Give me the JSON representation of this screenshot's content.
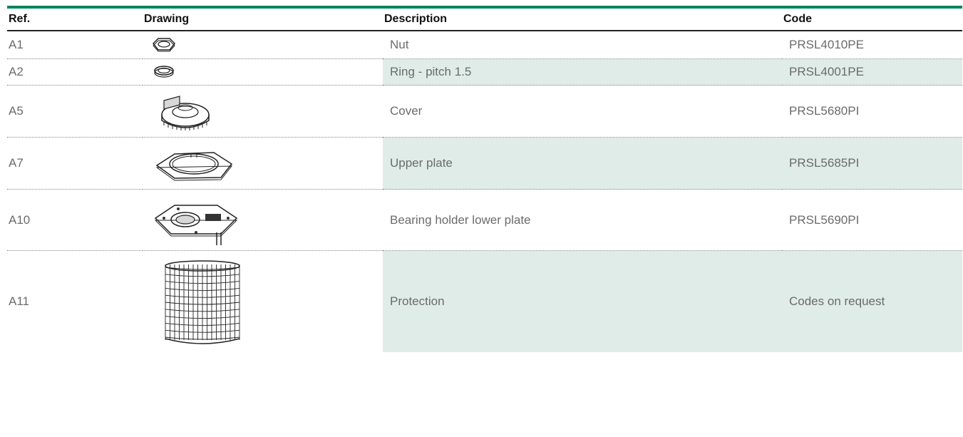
{
  "table": {
    "headers": {
      "ref": "Ref.",
      "drawing": "Drawing",
      "description": "Description",
      "code": "Code"
    },
    "rows": [
      {
        "ref": "A1",
        "drawing_icon": "hex-nut-icon",
        "description": "Nut",
        "code": "PRSL4010PE",
        "shaded": false
      },
      {
        "ref": "A2",
        "drawing_icon": "ring-icon",
        "description": "Ring - pitch 1.5",
        "code": "PRSL4001PE",
        "shaded": true
      },
      {
        "ref": "A5",
        "drawing_icon": "cover-icon",
        "description": "Cover",
        "code": "PRSL5680PI",
        "shaded": false
      },
      {
        "ref": "A7",
        "drawing_icon": "upper-plate-icon",
        "description": "Upper plate",
        "code": "PRSL5685PI",
        "shaded": true
      },
      {
        "ref": "A10",
        "drawing_icon": "bearing-plate-icon",
        "description": "Bearing holder lower plate",
        "code": "PRSL5690PI",
        "shaded": false
      },
      {
        "ref": "A11",
        "drawing_icon": "protection-grid-icon",
        "description": "Protection",
        "code": "Codes on request",
        "shaded": true
      }
    ]
  },
  "colors": {
    "accent": "#00855a",
    "shade": "#dfece8",
    "text": "#6b6b6b"
  }
}
